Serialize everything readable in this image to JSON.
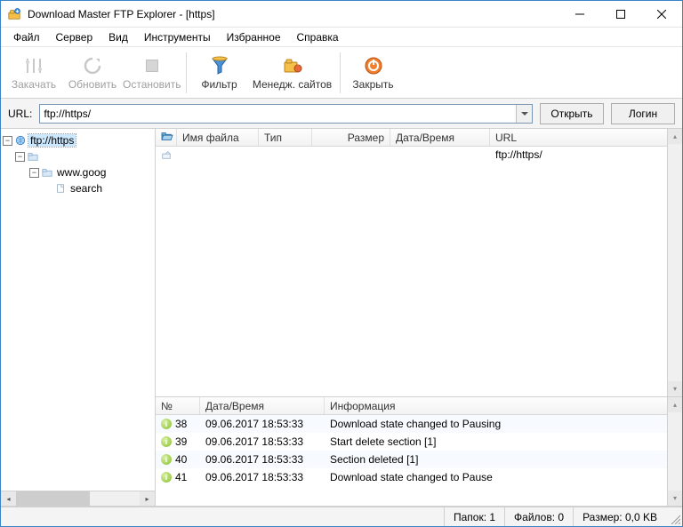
{
  "title": "Download Master FTP Explorer - [https]",
  "menu": [
    "Файл",
    "Сервер",
    "Вид",
    "Инструменты",
    "Избранное",
    "Справка"
  ],
  "toolbar": {
    "download": "Закачать",
    "refresh": "Обновить",
    "stop": "Остановить",
    "filter": "Фильтр",
    "sites": "Менедж. сайтов",
    "close": "Закрыть"
  },
  "url": {
    "label": "URL:",
    "value": "ftp://https/",
    "open": "Открыть",
    "login": "Логин"
  },
  "tree": {
    "root": "ftp://https",
    "child1": "www.goog",
    "child2": "search"
  },
  "filecols": {
    "name": "Имя файла",
    "type": "Тип",
    "size": "Размер",
    "date": "Дата/Время",
    "url": "URL"
  },
  "filerow": {
    "url": "ftp://https/"
  },
  "logcols": {
    "num": "№",
    "date": "Дата/Время",
    "info": "Информация"
  },
  "logs": [
    {
      "n": "38",
      "dt": "09.06.2017 18:53:33",
      "msg": "Download state changed to Pausing"
    },
    {
      "n": "39",
      "dt": "09.06.2017 18:53:33",
      "msg": "Start delete section [1]"
    },
    {
      "n": "40",
      "dt": "09.06.2017 18:53:33",
      "msg": "Section deleted [1]"
    },
    {
      "n": "41",
      "dt": "09.06.2017 18:53:33",
      "msg": "Download state changed to Pause"
    }
  ],
  "status": {
    "folders": "Папок: 1",
    "files": "Файлов: 0",
    "size": "Размер: 0,0 KB"
  }
}
